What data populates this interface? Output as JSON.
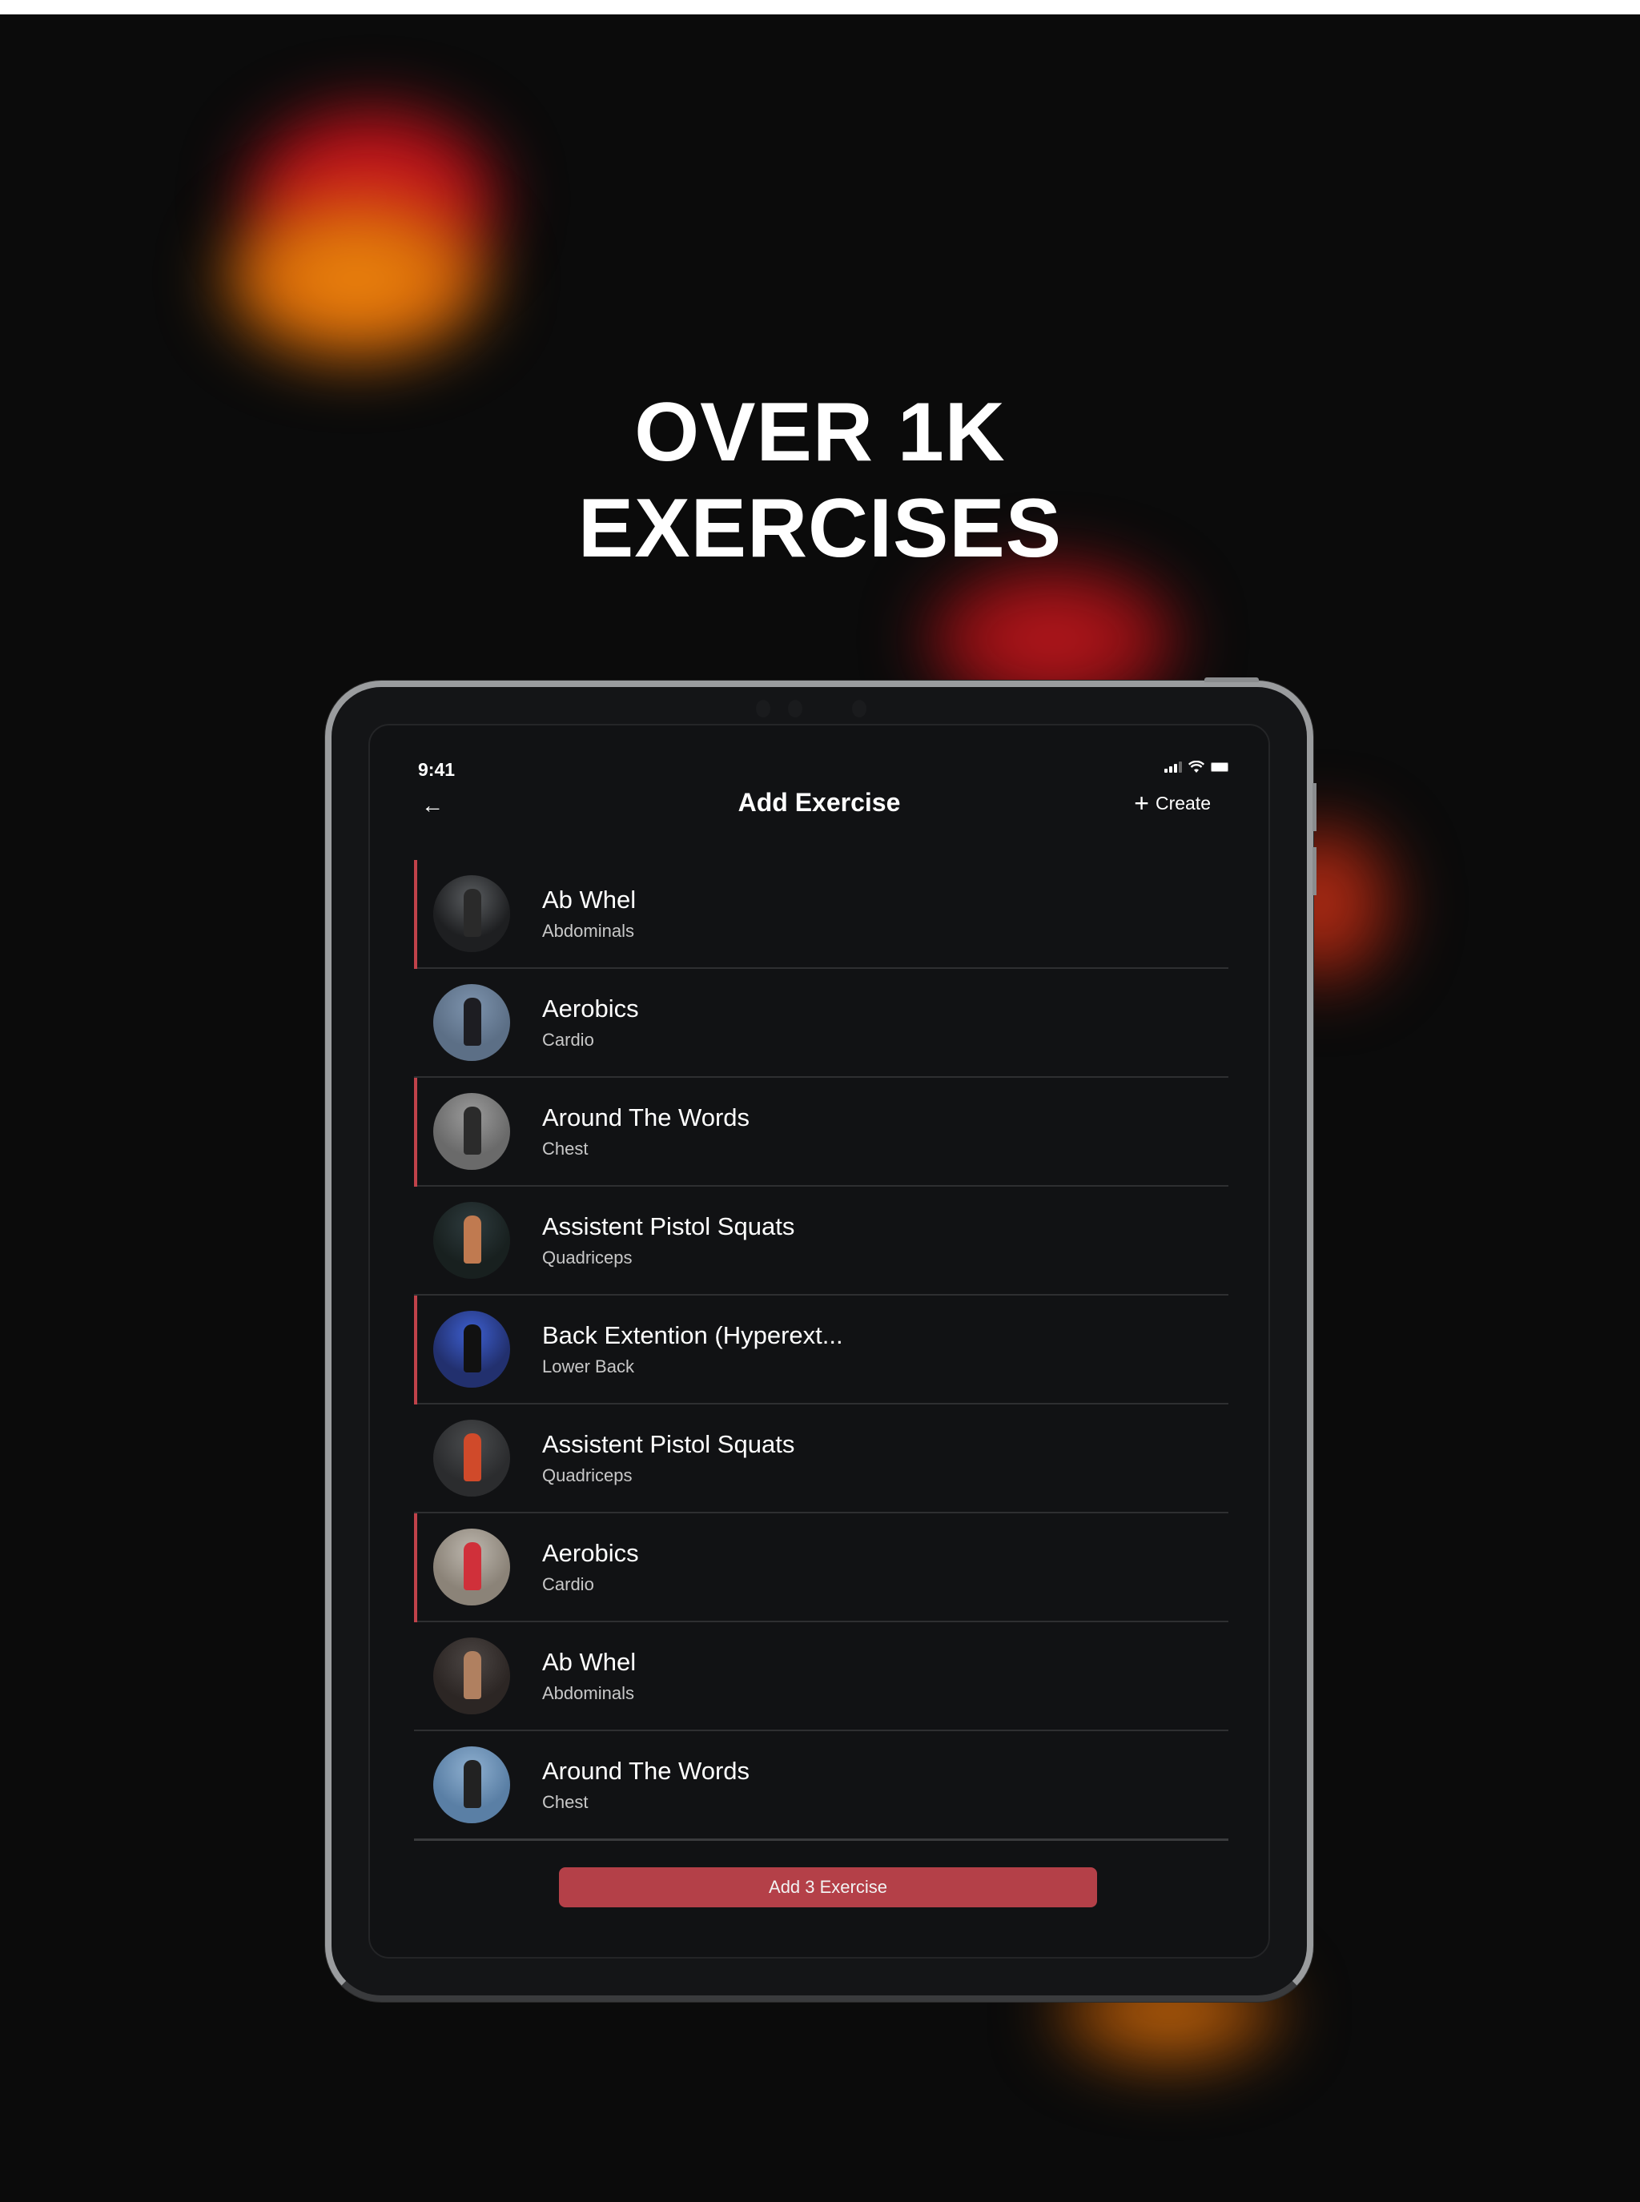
{
  "hero": {
    "line1": "OVER 1K",
    "line2": "EXERCISES"
  },
  "status_bar": {
    "time": "9:41",
    "icons": [
      "signal-icon",
      "wifi-icon",
      "battery-icon"
    ]
  },
  "nav": {
    "back_icon": "arrow-left-icon",
    "back_glyph": "←",
    "title": "Add Exercise",
    "create_icon": "plus-icon",
    "create_glyph": "+",
    "create_label": "Create"
  },
  "exercises": [
    {
      "name": "Ab Whel",
      "category": "Abdominals",
      "selected": true,
      "thumb_colors": [
        "#5a5d60",
        "#1e1f21",
        "#2a2a2a"
      ]
    },
    {
      "name": "Aerobics",
      "category": "Cardio",
      "selected": false,
      "thumb_colors": [
        "#7d93ad",
        "#5c6f86",
        "#1d1d22"
      ]
    },
    {
      "name": "Around The Words",
      "category": "Chest",
      "selected": true,
      "thumb_colors": [
        "#9b9b9b",
        "#6a6a6a",
        "#2b2b2b"
      ]
    },
    {
      "name": "Assistent Pistol Squats",
      "category": "Quadriceps",
      "selected": false,
      "thumb_colors": [
        "#2e3b3e",
        "#18201f",
        "#c07a50"
      ]
    },
    {
      "name": "Back Extention (Hyperext...",
      "category": "Lower Back",
      "selected": true,
      "thumb_colors": [
        "#3d5fd0",
        "#22306e",
        "#111"
      ]
    },
    {
      "name": "Assistent Pistol Squats",
      "category": "Quadriceps",
      "selected": false,
      "thumb_colors": [
        "#4a4c4e",
        "#2b2c2e",
        "#d04a2a"
      ]
    },
    {
      "name": "Aerobics",
      "category": "Cardio",
      "selected": true,
      "thumb_colors": [
        "#bdb7ae",
        "#8b8378",
        "#d0303a"
      ]
    },
    {
      "name": "Ab Whel",
      "category": "Abdominals",
      "selected": false,
      "thumb_colors": [
        "#4c4644",
        "#2c2624",
        "#b08060"
      ]
    },
    {
      "name": "Around The Words",
      "category": "Chest",
      "selected": false,
      "thumb_colors": [
        "#8fb0d0",
        "#5a7fa5",
        "#222"
      ]
    }
  ],
  "cta": {
    "label": "Add 3 Exercise"
  },
  "colors": {
    "accent": "#b44048",
    "selection_bar": "#c0424a",
    "screen_bg": "#111214",
    "page_bg": "#0b0b0b"
  }
}
